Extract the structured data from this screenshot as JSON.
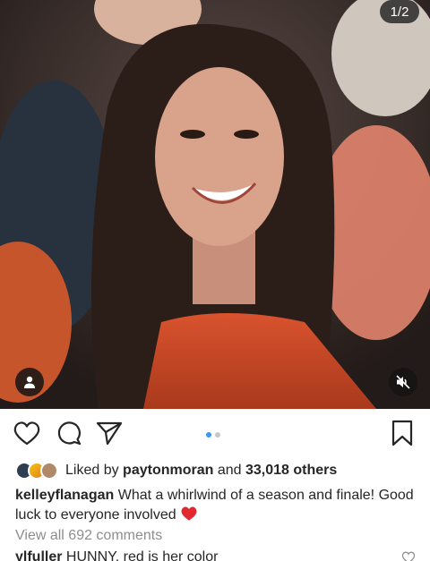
{
  "media": {
    "counter": "1/2",
    "tag_icon": "person-icon",
    "mute_icon": "muted-speaker-icon",
    "carousel_dots": 2,
    "active_dot": 0
  },
  "actions": {
    "like_icon": "heart-outline-icon",
    "comment_icon": "comment-bubble-icon",
    "share_icon": "paper-plane-icon",
    "save_icon": "bookmark-icon"
  },
  "likes": {
    "prefix": "Liked by",
    "user": "paytonmoran",
    "connector": "and",
    "count": "33,018 others"
  },
  "caption": {
    "username": "kelleyflanagan",
    "text": "What a whirlwind of a season and finale! Good luck to everyone involved",
    "emoji": "❤️"
  },
  "view_all_comments": "View all 692 comments",
  "comments": [
    {
      "username": "ylfuller",
      "text": "HUNNY, red is her color"
    }
  ],
  "colors": {
    "accent_blue": "#3897f0",
    "text": "#262626",
    "muted": "#8e8e8e",
    "heart_red": "#e0282e"
  }
}
